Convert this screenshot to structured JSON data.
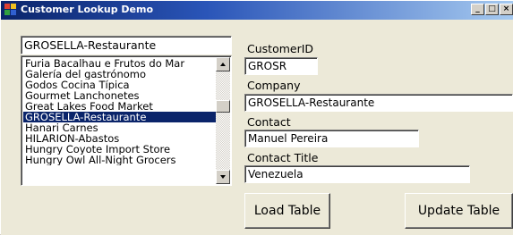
{
  "window": {
    "title": "Customer Lookup Demo",
    "minimize_glyph": "_",
    "maximize_glyph": "□",
    "close_glyph": "×"
  },
  "combo": {
    "value": "GROSELLA-Restaurante"
  },
  "listbox": {
    "items": [
      "Furia Bacalhau e Frutos do Mar",
      "Galería del gastrónomo",
      "Godos Cocina Típica",
      "Gourmet Lanchonetes",
      "Great Lakes Food Market",
      "GROSELLA-Restaurante",
      "Hanari Carnes",
      "HILARION-Abastos",
      "Hungry Coyote Import Store",
      "Hungry Owl All-Night Grocers"
    ],
    "selected_index": 5
  },
  "fields": {
    "customer_id_label": "CustomerID",
    "customer_id_value": "GROSR",
    "company_label": "Company",
    "company_value": "GROSELLA-Restaurante",
    "contact_label": "Contact",
    "contact_value": "Manuel Pereira",
    "contact_title_label": "Contact Title",
    "contact_title_value": "Venezuela"
  },
  "buttons": {
    "load_table": "Load Table",
    "update_table": "Update Table"
  },
  "colors": {
    "selection": "#0a246a",
    "titlebar_start": "#0a246a",
    "titlebar_end": "#a6caf0",
    "face": "#ece9d8"
  },
  "icons": {
    "app": "app-window-icon",
    "scroll_up": "arrow-up-icon",
    "scroll_down": "arrow-down-icon"
  }
}
